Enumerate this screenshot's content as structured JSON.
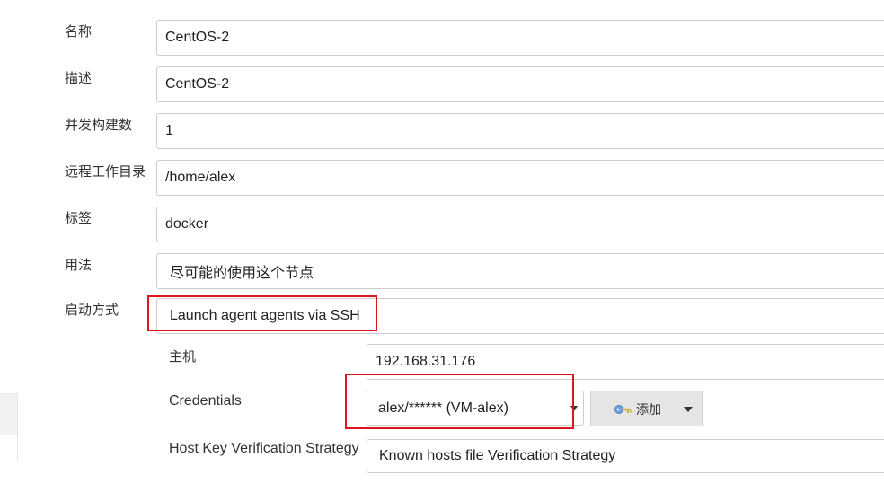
{
  "form": {
    "name": {
      "label": "名称",
      "value": "CentOS-2"
    },
    "description": {
      "label": "描述",
      "value": "CentOS-2"
    },
    "executors": {
      "label": "并发构建数",
      "value": "1"
    },
    "remote_root": {
      "label": "远程工作目录",
      "value": "/home/alex"
    },
    "labels": {
      "label": "标签",
      "value": "docker"
    },
    "usage": {
      "label": "用法",
      "value": "尽可能的使用这个节点"
    },
    "launch_method": {
      "label": "启动方式",
      "value": "Launch agent agents via SSH"
    },
    "ssh": {
      "host": {
        "label": "主机",
        "value": "192.168.31.176"
      },
      "credentials": {
        "label": "Credentials",
        "value": "alex/****** (VM-alex)",
        "add_button": {
          "label": "添加",
          "icon": "key-icon"
        }
      },
      "host_key_strategy": {
        "label": "Host Key Verification Strategy",
        "value": "Known hosts file Verification Strategy"
      }
    }
  },
  "colors": {
    "highlight": "#e0141e",
    "border": "#cccccc",
    "button_bg": "#e5e5e5"
  }
}
